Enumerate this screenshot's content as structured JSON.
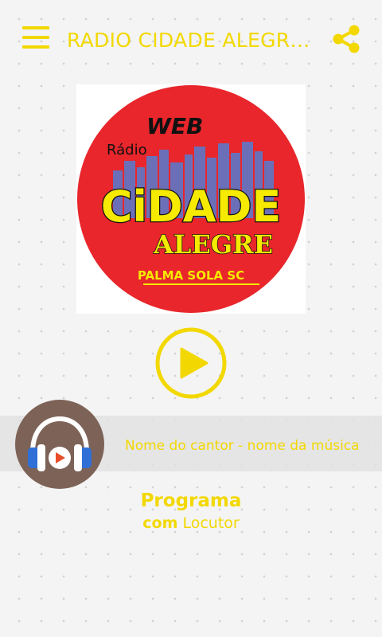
{
  "header": {
    "title": "RADIO CIDADE ALEGRE...",
    "menu_icon": "hamburger-menu-icon",
    "share_icon": "share-icon"
  },
  "logo": {
    "line_web": "WEB",
    "line_radio": "Rádio",
    "line_cidade": "CiDADE",
    "line_alegre": "ALEGRE",
    "line_city": "PALMA SOLA SC"
  },
  "player": {
    "play_icon": "play-icon",
    "track": "Nome do cantor - nome da música",
    "avatar_icon": "headphones-icon"
  },
  "program": {
    "name": "Programa",
    "with": "com",
    "announcer": "Locutor"
  },
  "colors": {
    "accent": "#f2d800",
    "background": "#f4f4f4",
    "avatar_bg": "#7d6357",
    "logo_red": "#e8262b"
  }
}
